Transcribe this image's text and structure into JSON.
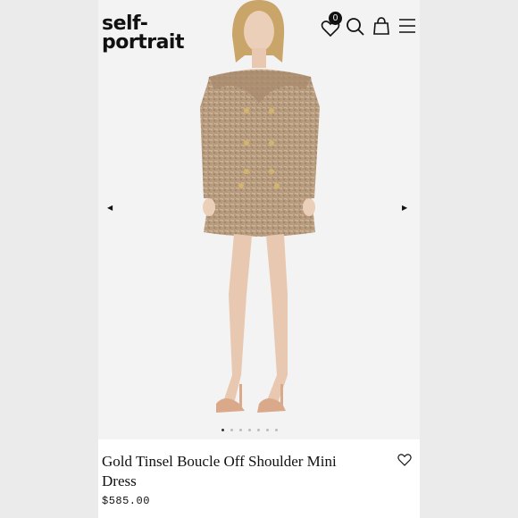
{
  "brand": {
    "line1": "self-",
    "line2": "portrait"
  },
  "header": {
    "cart_count": "0",
    "icons": [
      "heart-icon",
      "search-icon",
      "shopping-bag-icon",
      "menu-icon"
    ]
  },
  "gallery": {
    "prev_arrow": "◀",
    "next_arrow": "▶",
    "image_count": 7,
    "active_index": 0
  },
  "product": {
    "title": "Gold Tinsel Boucle Off Shoulder Mini Dress",
    "price": "$585.00"
  },
  "colors": {
    "background": "#f3f3f3",
    "text": "#111111",
    "dress": "#b69a7c",
    "shoe": "#d9a98a"
  }
}
